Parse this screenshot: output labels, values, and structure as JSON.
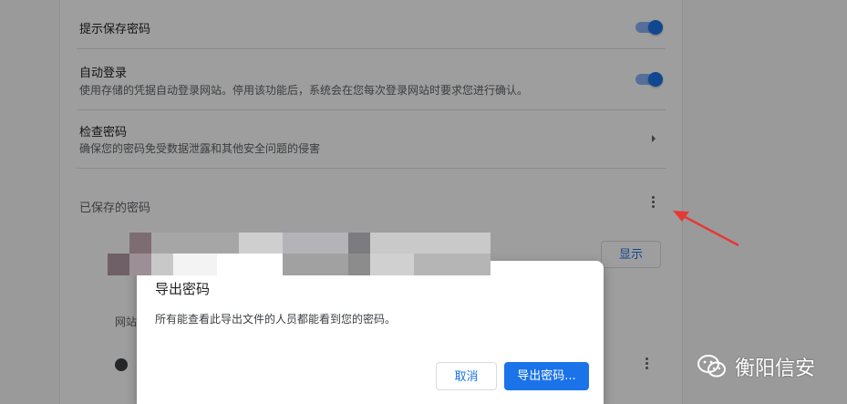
{
  "settings": {
    "offer_to_save": {
      "title": "提示保存密码",
      "enabled": true
    },
    "auto_sign_in": {
      "title": "自动登录",
      "subtitle": "使用存储的凭据自动登录网站。停用该功能后，系统会在您每次登录网站时要求您进行确认。",
      "enabled": true
    },
    "check_passwords": {
      "title": "检查密码",
      "subtitle": "确保您的密码免受数据泄露和其他安全问题的侵害"
    },
    "saved_passwords": {
      "title": "已保存的密码",
      "column_site_partial": "网站"
    },
    "show_button": "显示"
  },
  "dialog": {
    "title": "导出密码",
    "body": "所有能查看此导出文件的人员都能看到您的密码。",
    "cancel": "取消",
    "export": "导出密码..."
  },
  "watermark": {
    "text": "衡阳信安"
  },
  "colors": {
    "accent": "#1a73e8",
    "annotation_arrow": "#e53935"
  },
  "icons": [
    "chevron-right-icon",
    "more-vert-icon",
    "globe-icon",
    "wechat-icon",
    "red-arrow-annotation"
  ]
}
